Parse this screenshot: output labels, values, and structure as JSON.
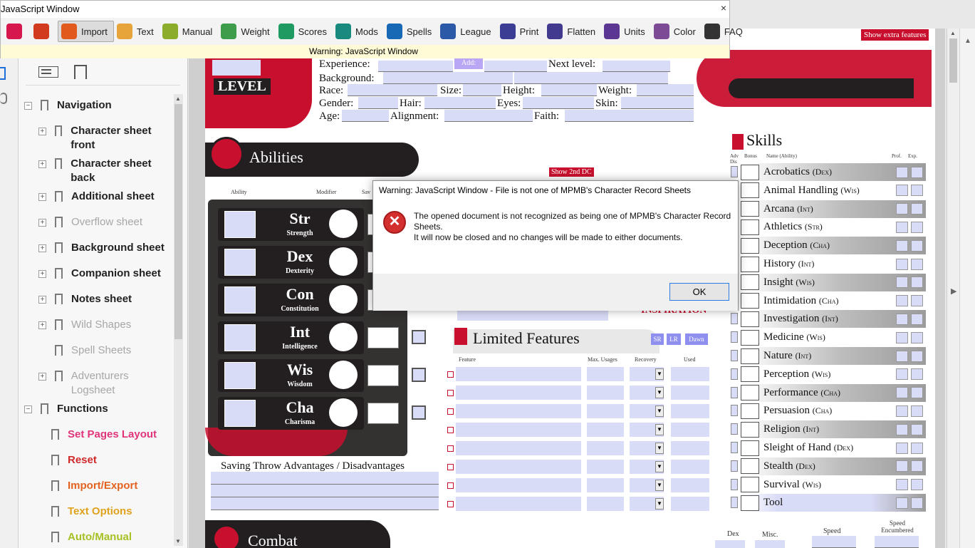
{
  "window": {
    "title": "JavaScript Window",
    "close": "×",
    "warning": "Warning: JavaScript Window"
  },
  "toolbar": [
    {
      "label": "",
      "icon": "copy-icon",
      "color": "#d6174d"
    },
    {
      "label": "",
      "icon": "power-icon",
      "color": "#d23a20"
    },
    {
      "label": "Import",
      "icon": "import-icon",
      "color": "#e2591e",
      "active": true
    },
    {
      "label": "Text",
      "icon": "text-icon",
      "color": "#e6a43a"
    },
    {
      "label": "Manual",
      "icon": "manual-icon",
      "color": "#8cad2b"
    },
    {
      "label": "Weight",
      "icon": "weight-icon",
      "color": "#3e9d4a"
    },
    {
      "label": "Scores",
      "icon": "scores-icon",
      "color": "#1f9b62"
    },
    {
      "label": "Mods",
      "icon": "mods-icon",
      "color": "#1a8a7f"
    },
    {
      "label": "Spells",
      "icon": "spells-icon",
      "color": "#1769b5"
    },
    {
      "label": "League",
      "icon": "league-icon",
      "color": "#2c58a8"
    },
    {
      "label": "Print",
      "icon": "print-icon",
      "color": "#3b3c94"
    },
    {
      "label": "Flatten",
      "icon": "flatten-icon",
      "color": "#413a8f"
    },
    {
      "label": "Units",
      "icon": "units-icon",
      "color": "#5b3793"
    },
    {
      "label": "Color",
      "icon": "color-icon",
      "color": "#7d4a95"
    },
    {
      "label": "FAQ",
      "icon": "faq-icon",
      "color": "#333333"
    }
  ],
  "nav": {
    "items": [
      {
        "label": "Navigation",
        "kind": "group",
        "expander": "−"
      },
      {
        "label": "Character sheet front",
        "kind": "item",
        "expander": "+"
      },
      {
        "label": "Character sheet back",
        "kind": "item",
        "expander": "+"
      },
      {
        "label": "Additional sheet",
        "kind": "item",
        "expander": "+"
      },
      {
        "label": "Overflow sheet",
        "kind": "dim",
        "expander": "+"
      },
      {
        "label": "Background sheet",
        "kind": "item",
        "expander": "+"
      },
      {
        "label": "Companion sheet",
        "kind": "item",
        "expander": "+"
      },
      {
        "label": "Notes sheet",
        "kind": "item",
        "expander": "+"
      },
      {
        "label": "Wild Shapes",
        "kind": "dim",
        "expander": "+"
      },
      {
        "label": "Spell Sheets",
        "kind": "dim",
        "expander": ""
      },
      {
        "label": "Adventurers Logsheet",
        "kind": "dim",
        "expander": "+"
      },
      {
        "label": "Functions",
        "kind": "group",
        "expander": "−"
      },
      {
        "label": "Set Pages Layout",
        "kind": "fn",
        "color": "#e0347a"
      },
      {
        "label": "Reset",
        "kind": "fn",
        "color": "#d0292a"
      },
      {
        "label": "Import/Export",
        "kind": "fn",
        "color": "#e3621f"
      },
      {
        "label": "Text Options",
        "kind": "fn",
        "color": "#e0a21d"
      },
      {
        "label": "Auto/Manual",
        "kind": "fn",
        "color": "#a6c124"
      }
    ]
  },
  "sheet": {
    "show_extra": "Show extra features",
    "level": "LEVEL",
    "add": "Add:",
    "fields": {
      "experience": "Experience:",
      "next_level": "Next level:",
      "background": "Background:",
      "race": "Race:",
      "size": "Size:",
      "height": "Height:",
      "weight": "Weight:",
      "gender": "Gender:",
      "hair": "Hair:",
      "eyes": "Eyes:",
      "skin": "Skin:",
      "age": "Age:",
      "alignment": "Alignment:",
      "faith": "Faith:"
    },
    "abilities_title": "Abilities",
    "show_2nd_dc": "Show 2nd DC",
    "col_ability": "Ability",
    "col_modifier": "Modifier",
    "col_sav": "Sav",
    "abilities": [
      {
        "abbr": "Str",
        "name": "Strength"
      },
      {
        "abbr": "Dex",
        "name": "Dexterity"
      },
      {
        "abbr": "Con",
        "name": "Constitution"
      },
      {
        "abbr": "Int",
        "name": "Intelligence"
      },
      {
        "abbr": "Wis",
        "name": "Wisdom"
      },
      {
        "abbr": "Cha",
        "name": "Charisma"
      }
    ],
    "saving_throw": "Saving Throw Advantages / Disadvantages",
    "inspiration": "Inspiration",
    "limited_features": "Limited Features",
    "lf_buttons": [
      "SR",
      "LR",
      "Dawn"
    ],
    "lf_cols": [
      "Feature",
      "Max. Usages",
      "Recovery",
      "Used"
    ],
    "combat": "Combat",
    "dex": "Dex",
    "misc": "Misc.",
    "speed": "Speed",
    "speed_enc": "Speed Encumbered",
    "skills_title": "Skills",
    "skills_cols": [
      "Adv Dis",
      "Bonus",
      "Name (Ability)",
      "Prof.",
      "Exp."
    ],
    "skills": [
      {
        "name": "Acrobatics",
        "abil": "(Dex)"
      },
      {
        "name": "Animal Handling",
        "abil": "(Wis)"
      },
      {
        "name": "Arcana",
        "abil": "(Int)"
      },
      {
        "name": "Athletics",
        "abil": "(Str)"
      },
      {
        "name": "Deception",
        "abil": "(Cha)"
      },
      {
        "name": "History",
        "abil": "(Int)"
      },
      {
        "name": "Insight",
        "abil": "(Wis)"
      },
      {
        "name": "Intimidation",
        "abil": "(Cha)"
      },
      {
        "name": "Investigation",
        "abil": "(Int)"
      },
      {
        "name": "Medicine",
        "abil": "(Wis)"
      },
      {
        "name": "Nature",
        "abil": "(Int)"
      },
      {
        "name": "Perception",
        "abil": "(Wis)"
      },
      {
        "name": "Performance",
        "abil": "(Cha)"
      },
      {
        "name": "Persuasion",
        "abil": "(Cha)"
      },
      {
        "name": "Religion",
        "abil": "(Int)"
      },
      {
        "name": "Sleight of Hand",
        "abil": "(Dex)"
      },
      {
        "name": "Stealth",
        "abil": "(Dex)"
      },
      {
        "name": "Survival",
        "abil": "(Wis)"
      },
      {
        "name": "Tool",
        "abil": ""
      }
    ]
  },
  "dialog": {
    "title": "Warning: JavaScript Window - File is not one of MPMB's Character Record Sheets",
    "line1": "The opened document is not recognized as being one of MPMB's Character Record Sheets.",
    "line2": "It will now be closed and no changes will be made to either documents.",
    "ok": "OK"
  },
  "colors": {
    "accent_red": "#c8102e",
    "field_blue": "#d9dcf7"
  }
}
